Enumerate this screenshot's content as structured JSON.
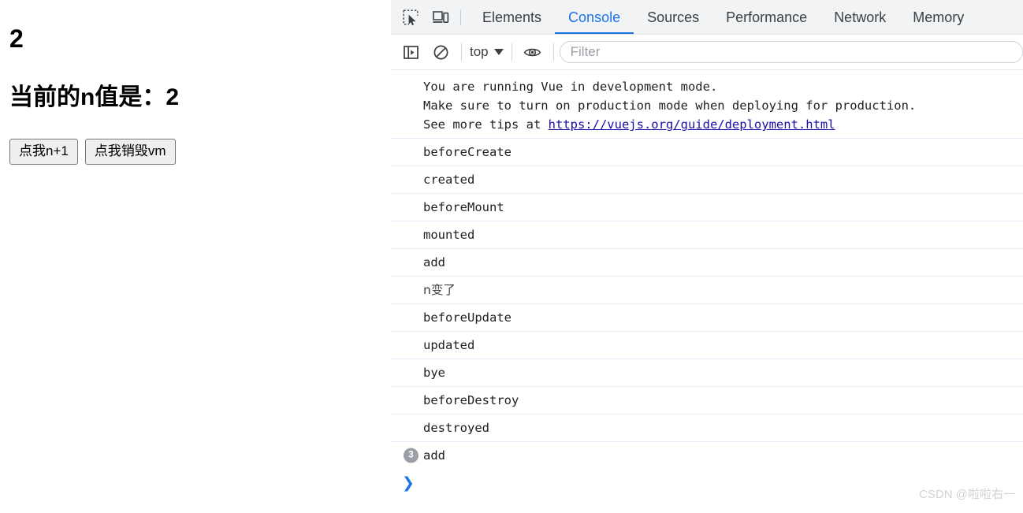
{
  "page": {
    "counter_display": "2",
    "heading": "当前的n值是：2",
    "buttons": [
      {
        "label": "点我n+1",
        "name": "increment-button"
      },
      {
        "label": "点我销毁vm",
        "name": "destroy-vm-button"
      }
    ]
  },
  "devtools": {
    "icons": {
      "inspect": "inspect-element-icon",
      "device": "device-toolbar-icon",
      "sidebar": "console-sidebar-icon",
      "clear": "clear-console-icon",
      "eye": "live-expression-eye-icon",
      "caret": "chevron-down-icon",
      "prompt": "prompt-chevron-icon"
    },
    "tabs": [
      {
        "label": "Elements",
        "active": false
      },
      {
        "label": "Console",
        "active": true
      },
      {
        "label": "Sources",
        "active": false
      },
      {
        "label": "Performance",
        "active": false
      },
      {
        "label": "Network",
        "active": false
      },
      {
        "label": "Memory",
        "active": false
      }
    ],
    "active_tab": "Console",
    "accent_color": "#1a73e8",
    "toolbar": {
      "context": "top",
      "filter_placeholder": "Filter",
      "filter_value": ""
    },
    "console": {
      "messages": [
        {
          "type": "multiline",
          "lines": [
            "You are running Vue in development mode.",
            "Make sure to turn on production mode when deploying for production.",
            "See more tips at "
          ],
          "link": "https://vuejs.org/guide/deployment.html"
        },
        {
          "type": "text",
          "text": "beforeCreate"
        },
        {
          "type": "text",
          "text": "created"
        },
        {
          "type": "text",
          "text": "beforeMount"
        },
        {
          "type": "text",
          "text": "mounted"
        },
        {
          "type": "text",
          "text": "add"
        },
        {
          "type": "cjk",
          "text": "n变了"
        },
        {
          "type": "text",
          "text": "beforeUpdate"
        },
        {
          "type": "text",
          "text": "updated"
        },
        {
          "type": "text",
          "text": "bye"
        },
        {
          "type": "text",
          "text": "beforeDestroy"
        },
        {
          "type": "text",
          "text": "destroyed"
        },
        {
          "type": "grouped",
          "text": "add",
          "count": "3"
        }
      ],
      "prompt_glyph": "❯"
    }
  },
  "watermark": "CSDN @啦啦右一"
}
